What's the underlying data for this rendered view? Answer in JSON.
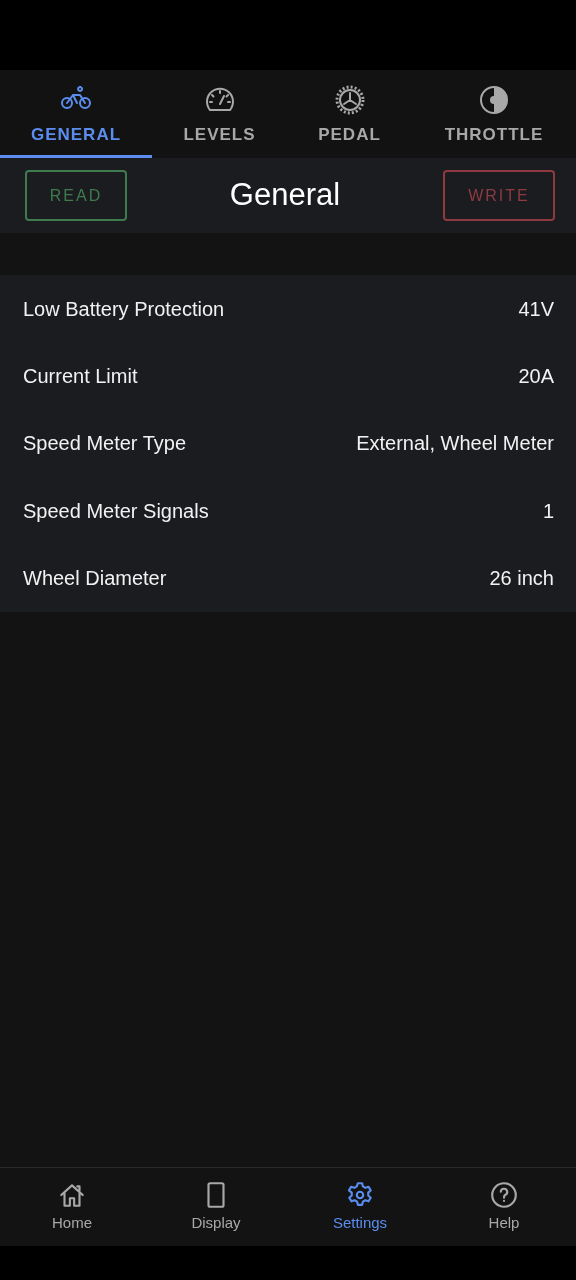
{
  "tabs": [
    {
      "label": "GENERAL",
      "selected": true
    },
    {
      "label": "LEVELS",
      "selected": false
    },
    {
      "label": "PEDAL",
      "selected": false
    },
    {
      "label": "THROTTLE",
      "selected": false
    }
  ],
  "header": {
    "read_button": "READ",
    "title": "General",
    "write_button": "WRITE"
  },
  "settings": [
    {
      "label": "Low Battery Protection",
      "value": "41V"
    },
    {
      "label": "Current Limit",
      "value": "20A"
    },
    {
      "label": "Speed Meter Type",
      "value": "External, Wheel Meter"
    },
    {
      "label": "Speed Meter Signals",
      "value": "1"
    },
    {
      "label": "Wheel Diameter",
      "value": "26 inch"
    }
  ],
  "bottom_nav": [
    {
      "label": "Home",
      "selected": false
    },
    {
      "label": "Display",
      "selected": false
    },
    {
      "label": "Settings",
      "selected": true
    },
    {
      "label": "Help",
      "selected": false
    }
  ]
}
